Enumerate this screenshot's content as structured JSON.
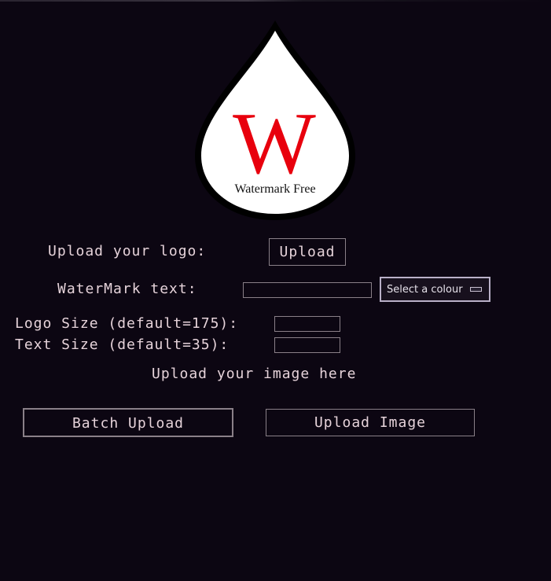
{
  "logo": {
    "letter": "W",
    "caption": "Watermark Free"
  },
  "labels": {
    "upload_logo": "Upload your logo:",
    "watermark_text": "WaterMark text:",
    "logo_size": "Logo Size (default=175):",
    "text_size": "Text Size (default=35):",
    "upload_image_here": "Upload your image here"
  },
  "buttons": {
    "upload": "Upload",
    "batch_upload": "Batch Upload",
    "upload_image": "Upload Image"
  },
  "fields": {
    "watermark_text": "",
    "logo_size": "",
    "text_size": ""
  },
  "color_picker": {
    "label": "Select a colour",
    "swatch_color": "#262030"
  },
  "colors": {
    "background": "#0c0612",
    "text": "#e6d3da",
    "logo_letter": "#e8000d",
    "border": "#8a8088"
  }
}
